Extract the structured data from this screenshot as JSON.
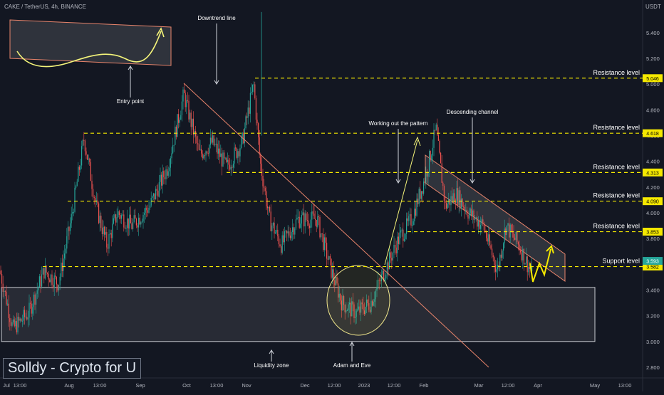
{
  "header": {
    "symbol": "CAKE / TetherUS, 4h, BINANCE",
    "currency": "USDT"
  },
  "branding": {
    "text": "Solldy - Crypto for U"
  },
  "colors": {
    "background": "#131722",
    "up": "#26a69a",
    "down": "#ef5350",
    "dashed": "#f5e900",
    "trend": "#e8846b",
    "text": "#b2b5be",
    "label": "#ffffff",
    "annotation": "#ffffff"
  },
  "chart_data": {
    "type": "candlestick",
    "title": "CAKE / TetherUS, 4h, BINANCE",
    "ylabel": "USDT",
    "ylim": [
      2.75,
      5.62
    ],
    "y_ticks": [
      "2.800",
      "3.000",
      "3.200",
      "3.400",
      "3.600",
      "3.800",
      "4.000",
      "4.200",
      "4.400",
      "4.600",
      "4.800",
      "5.000",
      "5.200",
      "5.400"
    ],
    "x_ticks": [
      "Jul",
      "13:00",
      "Aug",
      "13:00",
      "Sep",
      "Oct",
      "13:00",
      "Nov",
      "Dec",
      "12:00",
      "2023",
      "12:00",
      "Feb",
      "Mar",
      "12:00",
      "Apr",
      "May",
      "13:00"
    ],
    "price_path": [
      {
        "t": "Jul",
        "p": 3.55
      },
      {
        "t": "Jul-mid",
        "p": 3.1
      },
      {
        "t": "Jul-late",
        "p": 3.45
      },
      {
        "t": "Aug",
        "p": 3.9
      },
      {
        "t": "Aug-mid",
        "p": 4.6
      },
      {
        "t": "Aug-late",
        "p": 3.8
      },
      {
        "t": "Sep",
        "p": 4.05
      },
      {
        "t": "Sep-mid",
        "p": 4.4
      },
      {
        "t": "Oct",
        "p": 4.9
      },
      {
        "t": "Oct-mid",
        "p": 4.3
      },
      {
        "t": "Oct-late",
        "p": 4.55
      },
      {
        "t": "Nov",
        "p": 5.0
      },
      {
        "t": "Nov-mid",
        "p": 3.85
      },
      {
        "t": "Dec",
        "p": 3.95
      },
      {
        "t": "Dec-mid",
        "p": 3.25
      },
      {
        "t": "2023",
        "p": 3.2
      },
      {
        "t": "Jan-mid",
        "p": 3.75
      },
      {
        "t": "Feb",
        "p": 4.15
      },
      {
        "t": "Feb-early",
        "p": 4.65
      },
      {
        "t": "Feb-mid",
        "p": 3.95
      },
      {
        "t": "Feb-late",
        "p": 4.1
      },
      {
        "t": "Mar",
        "p": 3.5
      },
      {
        "t": "Mar-mid",
        "p": 3.85
      },
      {
        "t": "Apr",
        "p": 3.55
      }
    ],
    "levels": [
      {
        "name": "Resistance level",
        "value": 5.046,
        "label": "5.046"
      },
      {
        "name": "Resistance level",
        "value": 4.618,
        "label": "4.618"
      },
      {
        "name": "Resistance level",
        "value": 4.313,
        "label": "4.313"
      },
      {
        "name": "Resistance level",
        "value": 4.09,
        "label": "4.090"
      },
      {
        "name": "Resistance level",
        "value": 3.853,
        "label": "3.853"
      },
      {
        "name": "Support level",
        "value": 3.582,
        "label": "3.582"
      }
    ],
    "current_price": {
      "value": 3.593,
      "label": "3.593"
    },
    "zones": [
      {
        "name": "Liquidity zone",
        "from": 3.0,
        "to": 3.42
      }
    ],
    "patterns": [
      {
        "name": "Downtrend line"
      },
      {
        "name": "Descending channel"
      },
      {
        "name": "Adam and Eve"
      },
      {
        "name": "Working out the pattern"
      },
      {
        "name": "Entry point"
      }
    ],
    "annotations": [
      "Downtrend line",
      "Entry point",
      "Working out the pattern",
      "Descending channel",
      "Liquidity zone",
      "Adam and Eve"
    ],
    "grid": false,
    "legend": "none"
  }
}
